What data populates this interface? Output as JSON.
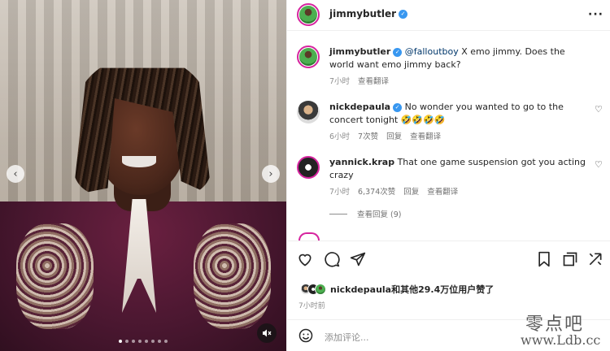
{
  "post": {
    "author": "jimmybutler",
    "caption_mention": "@falloutboy",
    "caption_text": " X emo jimmy. Does the world want emo jimmy back?",
    "caption_time": "7小时",
    "view_translation": "查看翻译"
  },
  "comments": [
    {
      "user": "nickdepaula",
      "verified": true,
      "text": "No wonder you wanted to go to the concert tonight 🤣🤣🤣🤣",
      "time": "6小时",
      "likes": "7次赞",
      "reply": "回复",
      "translate": "查看翻译"
    },
    {
      "user": "yannick.krap",
      "verified": false,
      "text": "That one game suspension got you acting crazy",
      "time": "7小时",
      "likes": "6,374次赞",
      "reply": "回复",
      "translate": "查看翻译",
      "view_replies": "查看回复 (9)"
    }
  ],
  "likes": {
    "user": "nickdepaula",
    "text": "nickdepaula和其他29.4万位用户赞了"
  },
  "post_time": "7小时前",
  "add_comment_placeholder": "添加评论...",
  "media": {
    "slide_count": 8,
    "active_slide": 1
  },
  "watermark": {
    "cn": "零点吧",
    "url": "www.Ldb.cc"
  },
  "colors": {
    "verified": "#3897f0",
    "story_ring": "#d6249f",
    "mention": "#00376b",
    "muted": "#8e8e8e"
  }
}
